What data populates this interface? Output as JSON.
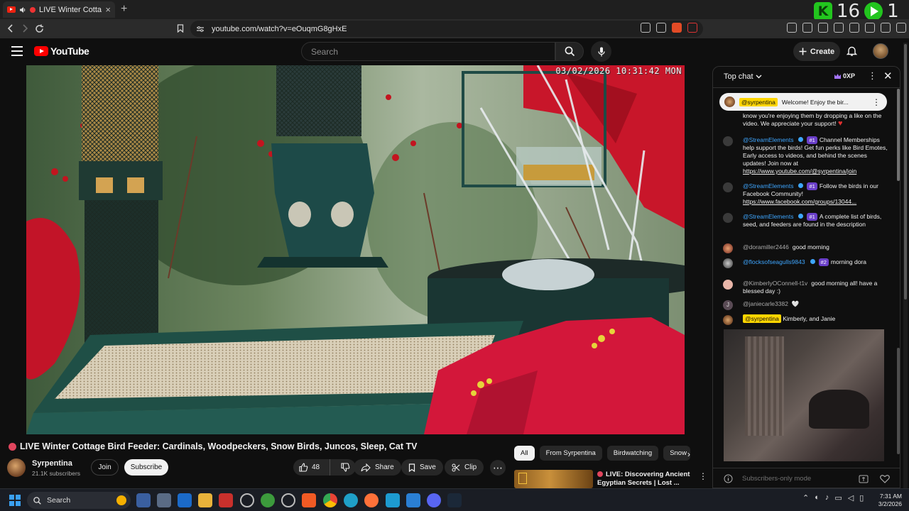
{
  "browser": {
    "tab_title": "LIVE Winter Cottage Bird F",
    "tab_close": "×",
    "new_tab": "+",
    "url": "youtube.com/watch?v=eOuqmG8gHxE",
    "overlay_count": "16",
    "overlay_extra": "1"
  },
  "header": {
    "logo_text": "YouTube",
    "search_placeholder": "Search",
    "create_label": "Create"
  },
  "video": {
    "timestamp": "03/02/2026 10:31:42 MON",
    "title": "LIVE Winter Cottage Bird Feeder: Cardinals, Woodpeckers, Snow Birds, Juncos, Sleep, Cat TV"
  },
  "channel": {
    "name": "Syrpentina",
    "subscribers": "21.1K subscribers",
    "join_label": "Join",
    "subscribe_label": "Subscribe"
  },
  "actions": {
    "likes": "48",
    "share_label": "Share",
    "save_label": "Save",
    "clip_label": "Clip",
    "more": "⋯"
  },
  "chips": {
    "all": "All",
    "from_channel": "From Syrpentina",
    "birdwatching": "Birdwatching",
    "snow": "Snow",
    "next": "›"
  },
  "recommendation": {
    "title": "LIVE: Discovering Ancient Egyptian Secrets | Lost ...",
    "menu": "⋮"
  },
  "chat": {
    "mode_label": "Top chat",
    "xp_label": "0XP",
    "pinned": {
      "owner_tag": "@syrpentina",
      "text": "Welcome! Enjoy the bir..."
    },
    "messages": [
      {
        "text": "know you're enjoying them by dropping a like on the video. We appreciate your support!"
      },
      {
        "author": "@StreamElements",
        "badge": "#1",
        "text": "Channel Memberships help support the birds! Get fun perks like Bird Emotes, Early access to videos, and behind the scenes updates! Join now at ",
        "link": "https://www.youtube.com/@syrpentina/join"
      },
      {
        "author": "@StreamElements",
        "badge": "#1",
        "text": "Follow the birds in our Facebook Community! ",
        "link": "https://www.facebook.com/groups/13044..."
      },
      {
        "author": "@StreamElements",
        "badge": "#1",
        "text": "A complete list of birds, seed, and feeders are found in the description"
      },
      {
        "author": "@doramiller2446",
        "text": "good morning"
      },
      {
        "author": "@flocksofseagulls9843",
        "badge": "#2",
        "text": "morning dora"
      },
      {
        "author": "@KimberlyOConnell-t1v",
        "text": "good morning all! have a blessed day :)"
      },
      {
        "author": "@janiecarle3382",
        "text": "🤍"
      },
      {
        "author": "@syrpentina",
        "text": "Kimberly, and Janie"
      }
    ],
    "input_placeholder": "Subscribers-only mode"
  },
  "taskbar": {
    "search_label": "Search",
    "time": "7:31 AM",
    "date": "3/2/2026"
  },
  "colors": {
    "background": "#0f0f0f",
    "yt_red": "#ff0000",
    "link_blue": "#3ea6ff",
    "owner_yellow": "#ffd600",
    "live_dot": "#e0455d"
  }
}
